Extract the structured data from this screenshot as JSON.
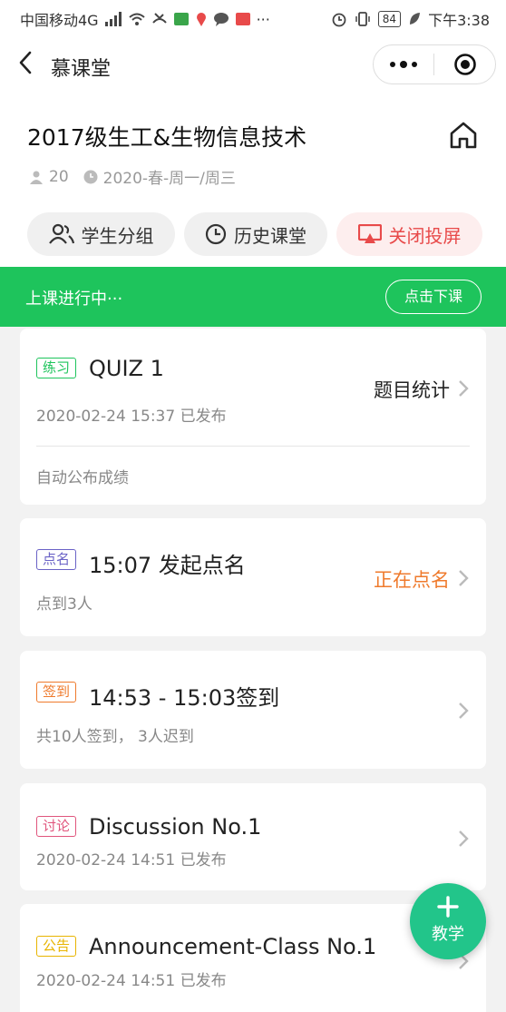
{
  "status_bar": {
    "carrier": "中国移动4G",
    "network": "4G",
    "battery": "84",
    "time": "下午3:38"
  },
  "nav": {
    "title": "慕课堂"
  },
  "course": {
    "title": "2017级生工&生物信息技术",
    "student_count": "20",
    "schedule": "2020-春-周一/周三"
  },
  "actions": [
    {
      "label": "学生分组"
    },
    {
      "label": "历史课堂"
    },
    {
      "label": "关闭投屏"
    }
  ],
  "banner": {
    "text": "上课进行中···",
    "button": "点击下课"
  },
  "colors": {
    "green": "#1ec45c",
    "fab": "#22c58a",
    "red": "#e84a4a"
  },
  "cards": [
    {
      "tag": "练习",
      "tag_color": "#1ec45c",
      "title": "QUIZ 1",
      "sub": "2020-02-24 15:37 已发布",
      "right": "题目统计",
      "right_color": "#222222",
      "footer": "自动公布成绩"
    },
    {
      "tag": "点名",
      "tag_color": "#6a62c6",
      "title": "15:07 发起点名",
      "sub": "点到3人",
      "right": "正在点名",
      "right_color": "#ef7a2c"
    },
    {
      "tag": "签到",
      "tag_color": "#ef7a2c",
      "title": "14:53 - 15:03签到",
      "sub": "共10人签到， 3人迟到"
    },
    {
      "tag": "讨论",
      "tag_color": "#e0557d",
      "title": "Discussion No.1",
      "sub": "2020-02-24 14:51 已发布"
    },
    {
      "tag": "公告",
      "tag_color": "#e8b400",
      "title": "Announcement-Class No.1",
      "sub": "2020-02-24 14:51 已发布"
    }
  ],
  "fab": {
    "label": "教学"
  }
}
